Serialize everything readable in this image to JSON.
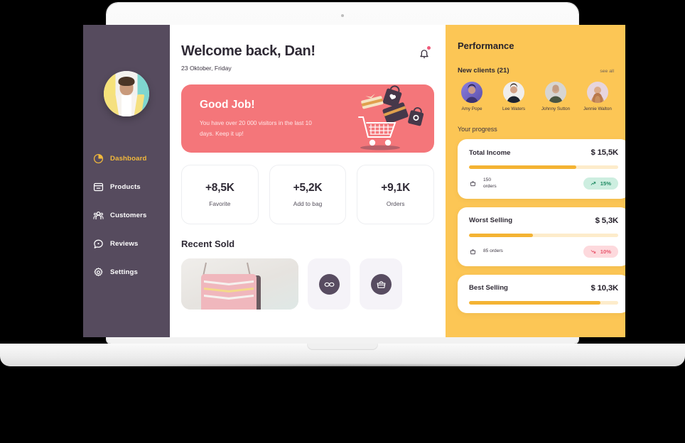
{
  "device": {
    "kind": "laptop-mockup"
  },
  "sidebar": {
    "avatar_name": "user-avatar",
    "items": [
      {
        "label": "Dashboard",
        "icon": "pie-chart-icon",
        "active": true
      },
      {
        "label": "Products",
        "icon": "window-icon",
        "active": false
      },
      {
        "label": "Customers",
        "icon": "people-icon",
        "active": false
      },
      {
        "label": "Reviews",
        "icon": "chat-bubble-icon",
        "active": false
      },
      {
        "label": "Settings",
        "icon": "gear-icon",
        "active": false
      }
    ]
  },
  "main": {
    "welcome_title": "Welcome back, Dan!",
    "date": "23 Oktober, Friday",
    "notification_icon": "bell-icon",
    "banner": {
      "title": "Good Job!",
      "text": "You have over 20 000 visitors in the last 10 days. Keep it up!",
      "art": "shopping-cart-illustration",
      "color": "#f4767a"
    },
    "stats": [
      {
        "value": "+8,5K",
        "label": "Favorite"
      },
      {
        "value": "+5,2K",
        "label": "Add to bag"
      },
      {
        "value": "+9,1K",
        "label": "Orders"
      }
    ],
    "recent_sold_title": "Recent Sold",
    "recent_items": [
      {
        "name": "pink-chevron-handbag-photo",
        "type": "photo"
      },
      {
        "name": "sunglasses-icon",
        "type": "icon"
      },
      {
        "name": "handbag-icon",
        "type": "icon"
      }
    ]
  },
  "performance": {
    "title": "Performance",
    "accent_color": "#fcc655",
    "clients_label": "New clients (21)",
    "see_all_label": "see all",
    "clients": [
      {
        "name": "Amy Pope"
      },
      {
        "name": "Lee Waters"
      },
      {
        "name": "Johnny Sutton"
      },
      {
        "name": "Jennie Walton"
      }
    ],
    "progress_label": "Your progress",
    "progress_cards": [
      {
        "name": "Total Income",
        "value": "$ 15,5K",
        "percent_filled": 72,
        "orders_line1": "150",
        "orders_line2": "orders",
        "badge": "15%",
        "direction": "up"
      },
      {
        "name": "Worst Selling",
        "value": "$  5,3K",
        "percent_filled": 43,
        "orders_line1": "85 orders",
        "orders_line2": "",
        "badge": "10%",
        "direction": "down"
      },
      {
        "name": "Best Selling",
        "value": "$ 10,3K",
        "percent_filled": 88,
        "orders_line1": "",
        "orders_line2": "",
        "badge": "",
        "direction": "up"
      }
    ]
  }
}
